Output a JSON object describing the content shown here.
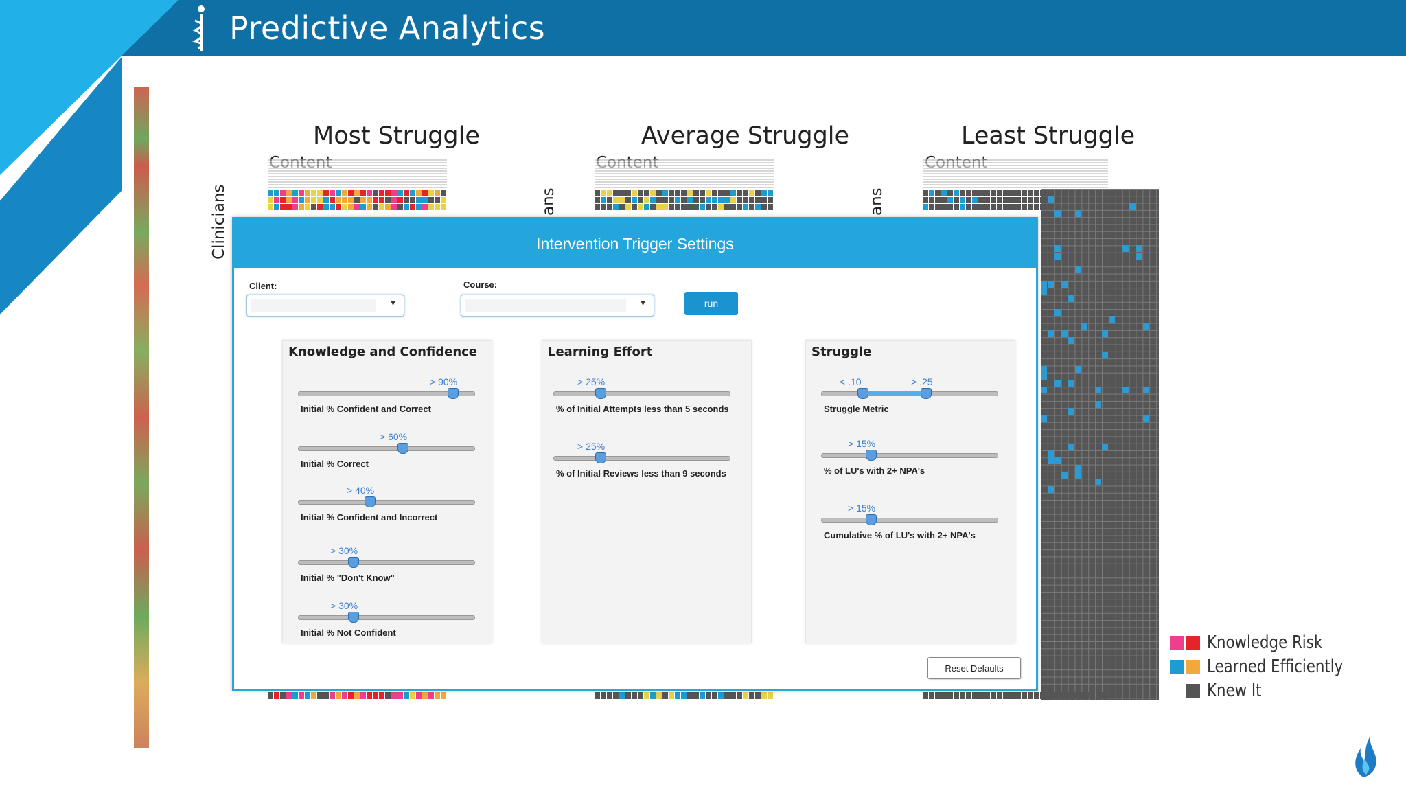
{
  "header": {
    "title": "Predictive Analytics",
    "logo_icon": "caduceus-icon",
    "bg": "#0e70a4"
  },
  "sections": [
    {
      "title": "Most Struggle",
      "content_label": "Content",
      "row_label": "Clinicians"
    },
    {
      "title": "Average Struggle",
      "content_label": "Content",
      "row_label": "ans"
    },
    {
      "title": "Least Struggle",
      "content_label": "Content",
      "row_label": "ans"
    }
  ],
  "dialog": {
    "title": "Intervention Trigger Settings",
    "client_label": "Client:",
    "course_label": "Course:",
    "client_value": "",
    "course_value": "",
    "run_label": "run",
    "reset_label": "Reset Defaults",
    "cards": [
      {
        "title": "Knowledge and Confidence",
        "sliders": [
          {
            "value_label": "> 90%",
            "value": 0.9,
            "label": "Initial % Confident and Correct"
          },
          {
            "value_label": "> 60%",
            "value": 0.6,
            "label": "Initial % Correct"
          },
          {
            "value_label": "> 40%",
            "value": 0.4,
            "label": "Initial % Confident and Incorrect"
          },
          {
            "value_label": "> 30%",
            "value": 0.3,
            "label": "Initial % \"Don't Know\""
          },
          {
            "value_label": "> 30%",
            "value": 0.3,
            "label": "Initial % Not Confident"
          }
        ]
      },
      {
        "title": "Learning Effort",
        "sliders": [
          {
            "value_label": "> 25%",
            "value": 0.25,
            "label": "% of Initial Attempts less than 5 seconds"
          },
          {
            "value_label": "> 25%",
            "value": 0.25,
            "label": "% of Initial Reviews less than 9 seconds"
          }
        ]
      },
      {
        "title": "Struggle",
        "sliders": [
          {
            "value_label": "< .10",
            "value_label_2": "> .25",
            "value": 0.1,
            "value_2": 0.25,
            "label": "Struggle Metric"
          },
          {
            "value_label": "> 15%",
            "value": 0.15,
            "label": "% of LU's with 2+ NPA's"
          },
          {
            "value_label": "> 15%",
            "value": 0.15,
            "label": "Cumulative % of LU's with 2+ NPA's"
          }
        ]
      }
    ]
  },
  "legend": [
    {
      "label": "Knowledge Risk",
      "colors": [
        "#ee3f8f",
        "#e5232b"
      ]
    },
    {
      "label": "Learned Efficiently",
      "colors": [
        "#1c9ccf",
        "#f2a93b"
      ]
    },
    {
      "label": "Knew It",
      "colors": [
        "#555555"
      ]
    }
  ],
  "colors": {
    "accent": "#24a6dc",
    "brand_dark": "#0e70a4",
    "brand_light": "#22b0e8"
  }
}
